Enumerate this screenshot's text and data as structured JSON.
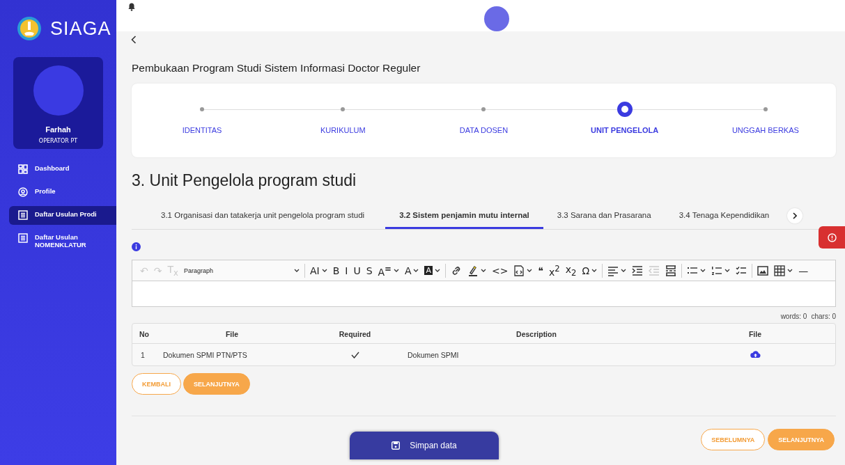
{
  "sidebar": {
    "app_name": "SIAGA",
    "user": {
      "name": "Farhah",
      "role": "OPERATOR PT"
    },
    "items": [
      {
        "label": "Dashboard",
        "kind": "grid",
        "selected": false
      },
      {
        "label": "Profile",
        "kind": "user",
        "selected": false
      },
      {
        "label": "Daftar Usulan Prodi",
        "kind": "list",
        "selected": true
      },
      {
        "label": "Daftar Usulan NOMENKLATUR",
        "kind": "list",
        "selected": false
      }
    ]
  },
  "page_title": "Pembukaan Program Studi Sistem Informasi Doctor Reguler",
  "steps": [
    {
      "label": "IDENTITAS",
      "selected": false
    },
    {
      "label": "KURIKULUM",
      "selected": false
    },
    {
      "label": "DATA DOSEN",
      "selected": false
    },
    {
      "label": "UNIT PENGELOLA",
      "selected": true
    },
    {
      "label": "UNGGAH BERKAS",
      "selected": false
    }
  ],
  "section_title": "3. Unit Pengelola program studi",
  "tabs": [
    {
      "label": "3.1 Organisasi dan tatakerja unit pengelola program studi",
      "selected": false
    },
    {
      "label": "3.2 Sistem penjamin mutu internal",
      "selected": true
    },
    {
      "label": "3.3 Sarana dan Prasarana",
      "selected": false
    },
    {
      "label": "3.4 Tenaga Kependidikan",
      "selected": false
    }
  ],
  "toolbar": [
    [
      {
        "kind": "text",
        "label": "↶",
        "dropdown": false,
        "disabled": true
      },
      {
        "kind": "text",
        "label": "↷",
        "dropdown": false,
        "disabled": true
      },
      {
        "kind": "text",
        "label": "T$_{x}$",
        "dropdown": false,
        "disabled": true
      },
      {
        "kind": "select",
        "label": "Paragraph",
        "dropdown": true,
        "disabled": false
      }
    ],
    [
      {
        "kind": "text",
        "label": "AI",
        "dropdown": true,
        "disabled": false
      },
      {
        "kind": "text",
        "label": "B",
        "dropdown": false,
        "disabled": false
      },
      {
        "kind": "text",
        "label": "I",
        "dropdown": false,
        "disabled": false
      },
      {
        "kind": "text",
        "label": "U",
        "dropdown": false,
        "disabled": false
      },
      {
        "kind": "text",
        "label": "S",
        "dropdown": false,
        "disabled": false
      },
      {
        "kind": "text",
        "label": "A$^{≡}$",
        "dropdown": true,
        "disabled": false
      },
      {
        "kind": "text",
        "label": "A",
        "dropdown": true,
        "disabled": false
      },
      {
        "kind": "inverse",
        "label": "A",
        "dropdown": true,
        "disabled": false
      }
    ],
    [
      {
        "kind": "link",
        "dropdown": false,
        "disabled": false
      },
      {
        "kind": "pen",
        "dropdown": true,
        "disabled": false
      },
      {
        "kind": "text",
        "label": "<>",
        "dropdown": false,
        "disabled": false
      },
      {
        "kind": "codeblock",
        "dropdown": true,
        "disabled": false
      },
      {
        "kind": "text",
        "label": "❝",
        "dropdown": false,
        "disabled": false
      },
      {
        "kind": "text",
        "label": "x$^{2}$",
        "dropdown": false,
        "disabled": false
      },
      {
        "kind": "text",
        "label": "x$_{2}$",
        "dropdown": false,
        "disabled": false
      },
      {
        "kind": "text",
        "label": "Ω",
        "dropdown": true,
        "disabled": false
      }
    ],
    [
      {
        "kind": "lines",
        "dropdown": true,
        "disabled": false
      },
      {
        "kind": "indent",
        "dropdown": false,
        "disabled": false
      },
      {
        "kind": "outdent",
        "dropdown": false,
        "disabled": true
      },
      {
        "kind": "pagebreak",
        "dropdown": false,
        "disabled": false
      }
    ],
    [
      {
        "kind": "bullets",
        "dropdown": true,
        "disabled": false
      },
      {
        "kind": "numbers",
        "dropdown": true,
        "disabled": false
      },
      {
        "kind": "todo",
        "dropdown": false,
        "disabled": false
      }
    ],
    [
      {
        "kind": "image",
        "dropdown": false,
        "disabled": false
      },
      {
        "kind": "table",
        "dropdown": true,
        "disabled": false
      },
      {
        "kind": "text",
        "label": "—",
        "dropdown": false,
        "disabled": false
      }
    ]
  ],
  "counter": {
    "words": "words: 0",
    "chars": "chars: 0"
  },
  "table": {
    "columns": [
      "No",
      "File",
      "Required",
      "Description",
      "File"
    ],
    "rows": [
      {
        "no": "1",
        "file": "Dokumen SPMI PTN/PTS",
        "required": true,
        "description": "Dokumen SPMI"
      }
    ]
  },
  "form_buttons": [
    {
      "label": "KEMBALI",
      "kind": "outline"
    },
    {
      "label": "SELANJUTNYA",
      "kind": "filled"
    }
  ],
  "save_button": "Simpan data",
  "footer_buttons": [
    {
      "label": "SEBELUMNYA",
      "kind": "outline"
    },
    {
      "label": "SELANJUTNYA",
      "kind": "filled"
    }
  ]
}
